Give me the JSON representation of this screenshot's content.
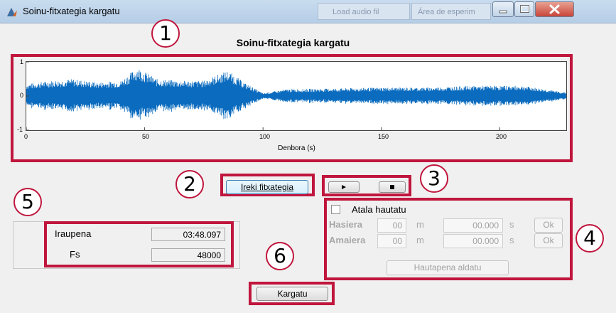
{
  "window": {
    "title": "Soinu-fitxategia kargatu"
  },
  "background_window": {
    "button1": "Load audio fil",
    "button2": "Área de esperim"
  },
  "plot": {
    "title": "Soinu-fitxategia kargatu",
    "xlabel": "Denbora (s)",
    "yticks": [
      "1",
      "0",
      "-1"
    ],
    "xticks": [
      "0",
      "50",
      "100",
      "150",
      "200"
    ]
  },
  "chart_data": {
    "type": "line",
    "title": "Soinu-fitxategia kargatu",
    "xlabel": "Denbora (s)",
    "ylabel": "",
    "xlim": [
      0,
      228.097
    ],
    "ylim": [
      -1,
      1
    ],
    "xticks": [
      0,
      50,
      100,
      150,
      200
    ],
    "yticks": [
      -1,
      0,
      1
    ],
    "series": [
      {
        "envelope": [
          {
            "x": 0,
            "amp": 0.35
          },
          {
            "x": 10,
            "amp": 0.45
          },
          {
            "x": 20,
            "amp": 0.5
          },
          {
            "x": 30,
            "amp": 0.4
          },
          {
            "x": 40,
            "amp": 0.45
          },
          {
            "x": 47,
            "amp": 0.85
          },
          {
            "x": 55,
            "amp": 0.5
          },
          {
            "x": 65,
            "amp": 0.45
          },
          {
            "x": 75,
            "amp": 0.45
          },
          {
            "x": 85,
            "amp": 0.75
          },
          {
            "x": 92,
            "amp": 0.4
          },
          {
            "x": 100,
            "amp": 0.08
          },
          {
            "x": 110,
            "amp": 0.2
          },
          {
            "x": 130,
            "amp": 0.22
          },
          {
            "x": 150,
            "amp": 0.25
          },
          {
            "x": 170,
            "amp": 0.25
          },
          {
            "x": 190,
            "amp": 0.3
          },
          {
            "x": 210,
            "amp": 0.3
          },
          {
            "x": 228.097,
            "amp": 0.1
          }
        ]
      }
    ],
    "color": "#0b6cbf"
  },
  "controls": {
    "open_label": "Ireki fitxategia",
    "play_icon": "play-icon",
    "stop_icon": "stop-icon",
    "select_label": "Atala hautatu",
    "hasiera_label": "Hasiera",
    "amaiera_label": "Amaiera",
    "hasiera_min": "00",
    "hasiera_sec": "00.000",
    "amaiera_min": "00",
    "amaiera_sec": "00.000",
    "unit_m": "m",
    "unit_s": "s",
    "ok_label": "Ok",
    "update_label": "Hautapena aldatu",
    "duration_label": "Iraupena",
    "duration_value": "03:48.097",
    "fs_label": "Fs",
    "fs_value": "48000",
    "load_label": "Kargatu"
  },
  "badges": [
    "1",
    "2",
    "3",
    "4",
    "5",
    "6"
  ],
  "colors": {
    "highlight": "#c0163d",
    "waveform": "#0b6cbf"
  }
}
